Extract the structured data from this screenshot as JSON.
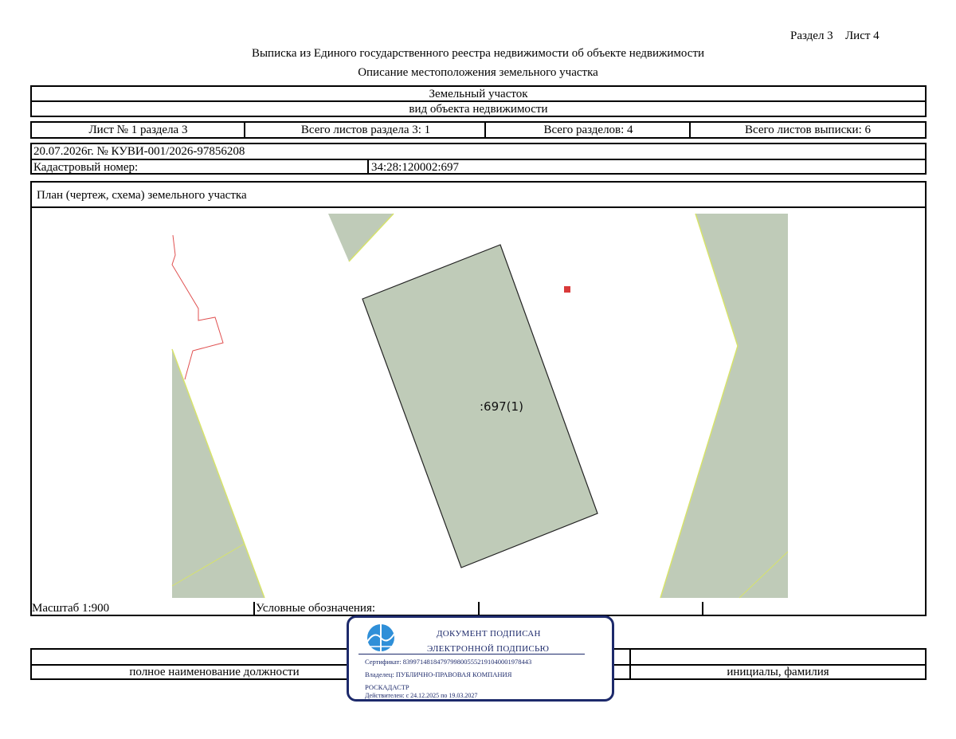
{
  "header": {
    "section_ref": "Раздел 3",
    "sheet_ref": "Лист 4",
    "title": "Выписка из Единого государственного реестра недвижимости об объекте недвижимости",
    "subtitle": "Описание местоположения земельного участка"
  },
  "object": {
    "type_value": "Земельный участок",
    "type_caption": "вид объекта недвижимости"
  },
  "sheets": {
    "sheet_no": "Лист № 1 раздела 3",
    "total_sheets_section": "Всего листов раздела 3: 1",
    "total_sections": "Всего разделов: 4",
    "total_sheets_extract": "Всего листов выписки: 6"
  },
  "record": {
    "date_number": "20.07.2026г. № КУВИ-001/2026-97856208",
    "cadastral_label": "Кадастровый номер:",
    "cadastral_value": "34:28:120002:697"
  },
  "plan": {
    "heading": "План (чертеж, схема) земельного участка",
    "parcel_label": ":697(1)",
    "colors": {
      "parcel_fill": "#bfcbb8",
      "boundary_line": "#d7e36b",
      "neighbor_line": "#e05050",
      "marker": "#d93a3a"
    }
  },
  "legend": {
    "scale": "Масштаб 1:900",
    "symbols_label": "Условные обозначения:"
  },
  "footer": {
    "position_caption": "полное наименование должности",
    "name_caption": "инициалы, фамилия"
  },
  "signature": {
    "line1": "ДОКУМЕНТ ПОДПИСАН",
    "line2": "ЭЛЕКТРОННОЙ ПОДПИСЬЮ",
    "certificate": "Сертификат: 839971481847979980055521910400019784​43",
    "owner": "Владелец: ПУБЛИЧНО-ПРАВОВАЯ КОМПАНИЯ",
    "owner_cont": "РОСКАДАСТР",
    "valid": "Действителен: с 24.12.2025 по 19.03.2027",
    "colors": {
      "ink": "#1d2a6b",
      "logo_blue": "#2f8fd8"
    }
  }
}
